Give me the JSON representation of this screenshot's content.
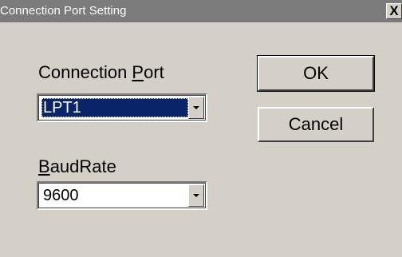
{
  "window": {
    "title": "Connection Port Setting",
    "close_label": "X"
  },
  "connection_port": {
    "label_before": "Connection ",
    "label_accel": "P",
    "label_after": "ort",
    "value": "LPT1"
  },
  "baud_rate": {
    "label_accel": "B",
    "label_after": "audRate",
    "value": "9600"
  },
  "buttons": {
    "ok": "OK",
    "cancel": "Cancel"
  },
  "colors": {
    "titlebar_inactive": "#7b7b7b",
    "dialog_face": "#d4d0c8",
    "selection": "#0a246a"
  }
}
